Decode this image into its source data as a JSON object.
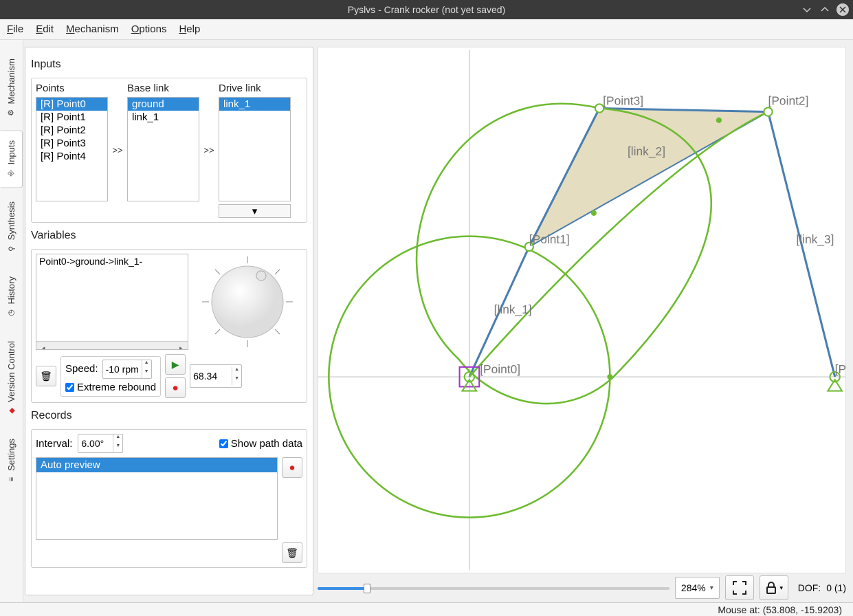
{
  "window": {
    "title": "Pyslvs - Crank rocker (not yet saved)"
  },
  "menu": [
    "File",
    "Edit",
    "Mechanism",
    "Options",
    "Help"
  ],
  "vtabs": [
    {
      "label": "Mechanism",
      "icon": "⚙"
    },
    {
      "label": "Inputs",
      "icon": "⎆"
    },
    {
      "label": "Synthesis",
      "icon": "⚲"
    },
    {
      "label": "History",
      "icon": "◷"
    },
    {
      "label": "Version Control",
      "icon": "◆"
    },
    {
      "label": "Settings",
      "icon": "≡"
    }
  ],
  "inputs": {
    "title": "Inputs",
    "points_label": "Points",
    "base_label": "Base link",
    "drive_label": "Drive link",
    "points": [
      "[R] Point0",
      "[R] Point1",
      "[R] Point2",
      "[R] Point3",
      "[R] Point4"
    ],
    "points_sel": 0,
    "base_links": [
      "ground",
      "link_1"
    ],
    "base_sel": 0,
    "drive_links": [
      "link_1"
    ],
    "drive_sel": 0
  },
  "variables": {
    "title": "Variables",
    "items": [
      "Point0->ground->link_1-"
    ],
    "speed_label": "Speed:",
    "speed_value": "-10 rpm",
    "extreme_label": "Extreme rebound",
    "extreme_checked": true,
    "angle_value": "68.34"
  },
  "records": {
    "title": "Records",
    "interval_label": "Interval:",
    "interval_value": "6.00°",
    "show_path_label": "Show path data",
    "show_path_checked": true,
    "items": [
      "Auto preview"
    ],
    "sel": 0
  },
  "canvas": {
    "zoom": "284%",
    "dof_label": "DOF:",
    "dof_value": "0 (1)",
    "labels": {
      "p0": "[Point0]",
      "p1": "[Point1]",
      "p2": "[Point2]",
      "p3": "[Point3]",
      "l1": "[link_1]",
      "l2": "[link_2]",
      "l3": "[link_3]",
      "p4": "[P"
    }
  },
  "status": {
    "mouse_label": "Mouse at:",
    "mouse_value": "(53.808, -15.9203)"
  },
  "colors": {
    "selection": "#2f8ad8",
    "link_fill": "#d8cfa5",
    "joint_stroke": "#4a7eb0",
    "path_stroke": "#6cbb2e",
    "marker": "#a236c9"
  }
}
